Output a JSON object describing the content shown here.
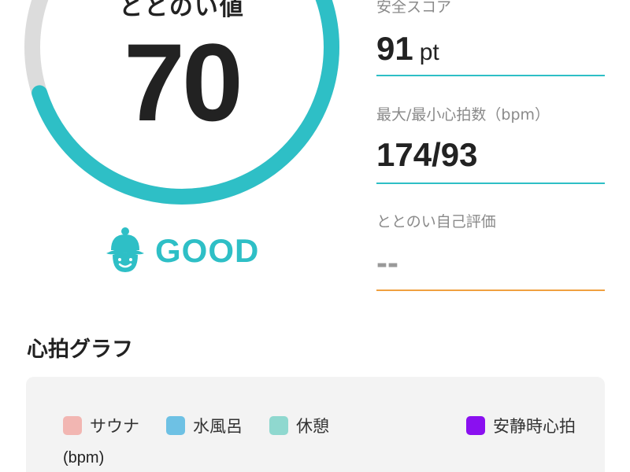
{
  "gauge": {
    "title": "ととのい値",
    "value": "70",
    "progress_fraction": 0.7,
    "track_color": "#dcdcdc",
    "progress_color": "#2ebfc6",
    "rating_icon": "sauna-hat-face-icon",
    "rating_label": "GOOD",
    "rating_color": "#2ebfc6"
  },
  "stats": {
    "safety_score": {
      "label": "安全スコア",
      "value": "91",
      "unit": "pt",
      "underline_color": "#2ebfc6"
    },
    "heart_rate": {
      "label": "最大/最小心拍数（bpm）",
      "value": "174/93",
      "underline_color": "#2ebfc6"
    },
    "self_evaluation": {
      "label": "ととのい自己評価",
      "value": "--",
      "underline_color": "#f0a040"
    }
  },
  "graph": {
    "title": "心拍グラフ",
    "legend": [
      {
        "label": "サウナ",
        "color": "#f2b6b2"
      },
      {
        "label": "水風呂",
        "color": "#6ec1e4"
      },
      {
        "label": "休憩",
        "color": "#8fd8cf"
      },
      {
        "label": "安静時心拍",
        "color": "#8a10f0"
      }
    ],
    "y_unit": "(bpm)"
  }
}
